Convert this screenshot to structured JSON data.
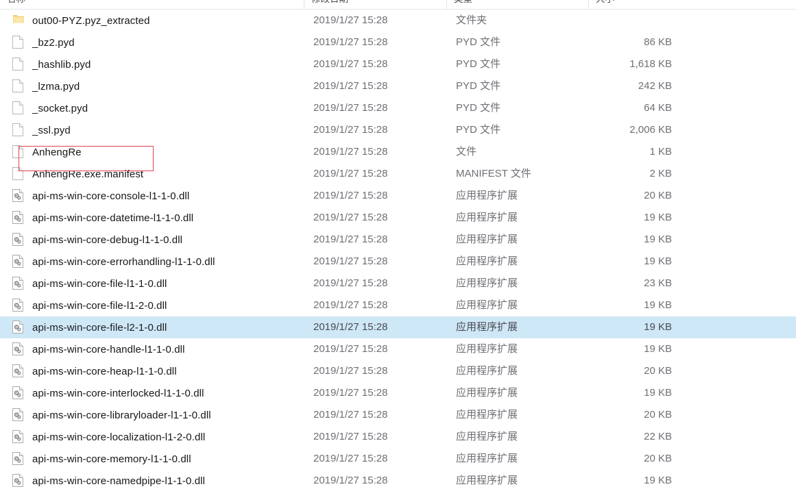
{
  "window": {
    "view_mode": "details"
  },
  "columns": {
    "name": "名称",
    "date_modified": "修改日期",
    "type": "类型",
    "size": "大小"
  },
  "colors": {
    "selection_row": "#cfe8f7",
    "annotation_border": "#e04250",
    "folder_icon": "#f8d775",
    "text_primary": "#161616",
    "text_secondary": "#6f6f76"
  },
  "annotation": {
    "label": "highlight-box",
    "target_row": "AnhengRe"
  },
  "files": [
    {
      "name": "out00-PYZ.pyz_extracted",
      "date": "2019/1/27 15:28",
      "type": "文件夹",
      "size": "",
      "icon": "folder-icon",
      "selected": false
    },
    {
      "name": "_bz2.pyd",
      "date": "2019/1/27 15:28",
      "type": "PYD 文件",
      "size": "86 KB",
      "icon": "file-icon",
      "selected": false
    },
    {
      "name": "_hashlib.pyd",
      "date": "2019/1/27 15:28",
      "type": "PYD 文件",
      "size": "1,618 KB",
      "icon": "file-icon",
      "selected": false
    },
    {
      "name": "_lzma.pyd",
      "date": "2019/1/27 15:28",
      "type": "PYD 文件",
      "size": "242 KB",
      "icon": "file-icon",
      "selected": false
    },
    {
      "name": "_socket.pyd",
      "date": "2019/1/27 15:28",
      "type": "PYD 文件",
      "size": "64 KB",
      "icon": "file-icon",
      "selected": false
    },
    {
      "name": "_ssl.pyd",
      "date": "2019/1/27 15:28",
      "type": "PYD 文件",
      "size": "2,006 KB",
      "icon": "file-icon",
      "selected": false
    },
    {
      "name": "AnhengRe",
      "date": "2019/1/27 15:28",
      "type": "文件",
      "size": "1 KB",
      "icon": "file-icon",
      "selected": false
    },
    {
      "name": "AnhengRe.exe.manifest",
      "date": "2019/1/27 15:28",
      "type": "MANIFEST 文件",
      "size": "2 KB",
      "icon": "file-icon",
      "selected": false
    },
    {
      "name": "api-ms-win-core-console-l1-1-0.dll",
      "date": "2019/1/27 15:28",
      "type": "应用程序扩展",
      "size": "20 KB",
      "icon": "dll-icon",
      "selected": false
    },
    {
      "name": "api-ms-win-core-datetime-l1-1-0.dll",
      "date": "2019/1/27 15:28",
      "type": "应用程序扩展",
      "size": "19 KB",
      "icon": "dll-icon",
      "selected": false
    },
    {
      "name": "api-ms-win-core-debug-l1-1-0.dll",
      "date": "2019/1/27 15:28",
      "type": "应用程序扩展",
      "size": "19 KB",
      "icon": "dll-icon",
      "selected": false
    },
    {
      "name": "api-ms-win-core-errorhandling-l1-1-0.dll",
      "date": "2019/1/27 15:28",
      "type": "应用程序扩展",
      "size": "19 KB",
      "icon": "dll-icon",
      "selected": false
    },
    {
      "name": "api-ms-win-core-file-l1-1-0.dll",
      "date": "2019/1/27 15:28",
      "type": "应用程序扩展",
      "size": "23 KB",
      "icon": "dll-icon",
      "selected": false
    },
    {
      "name": "api-ms-win-core-file-l1-2-0.dll",
      "date": "2019/1/27 15:28",
      "type": "应用程序扩展",
      "size": "19 KB",
      "icon": "dll-icon",
      "selected": false
    },
    {
      "name": "api-ms-win-core-file-l2-1-0.dll",
      "date": "2019/1/27 15:28",
      "type": "应用程序扩展",
      "size": "19 KB",
      "icon": "dll-icon",
      "selected": true
    },
    {
      "name": "api-ms-win-core-handle-l1-1-0.dll",
      "date": "2019/1/27 15:28",
      "type": "应用程序扩展",
      "size": "19 KB",
      "icon": "dll-icon",
      "selected": false
    },
    {
      "name": "api-ms-win-core-heap-l1-1-0.dll",
      "date": "2019/1/27 15:28",
      "type": "应用程序扩展",
      "size": "20 KB",
      "icon": "dll-icon",
      "selected": false
    },
    {
      "name": "api-ms-win-core-interlocked-l1-1-0.dll",
      "date": "2019/1/27 15:28",
      "type": "应用程序扩展",
      "size": "19 KB",
      "icon": "dll-icon",
      "selected": false
    },
    {
      "name": "api-ms-win-core-libraryloader-l1-1-0.dll",
      "date": "2019/1/27 15:28",
      "type": "应用程序扩展",
      "size": "20 KB",
      "icon": "dll-icon",
      "selected": false
    },
    {
      "name": "api-ms-win-core-localization-l1-2-0.dll",
      "date": "2019/1/27 15:28",
      "type": "应用程序扩展",
      "size": "22 KB",
      "icon": "dll-icon",
      "selected": false
    },
    {
      "name": "api-ms-win-core-memory-l1-1-0.dll",
      "date": "2019/1/27 15:28",
      "type": "应用程序扩展",
      "size": "20 KB",
      "icon": "dll-icon",
      "selected": false
    },
    {
      "name": "api-ms-win-core-namedpipe-l1-1-0.dll",
      "date": "2019/1/27 15:28",
      "type": "应用程序扩展",
      "size": "19 KB",
      "icon": "dll-icon",
      "selected": false
    }
  ]
}
